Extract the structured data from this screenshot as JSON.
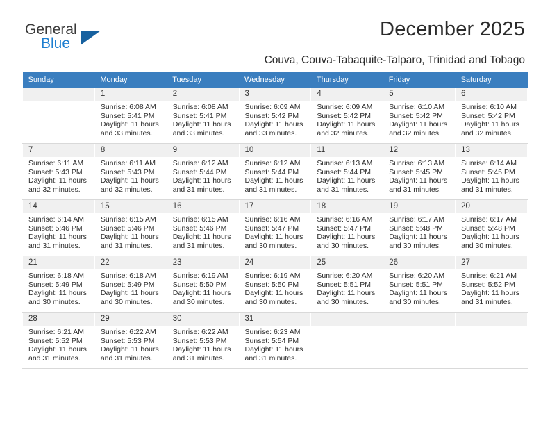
{
  "brand": {
    "name_top": "General",
    "name_bottom": "Blue",
    "triangle_icon": "triangle-icon",
    "accent_color": "#17619f",
    "blue_color": "#1f7fd0"
  },
  "header": {
    "title": "December 2025",
    "subtitle": "Couva, Couva-Tabaquite-Talparo, Trinidad and Tobago"
  },
  "calendar": {
    "header_bg": "#3a7ebf",
    "daynum_bg": "#f0f0f0",
    "weekdays": [
      "Sunday",
      "Monday",
      "Tuesday",
      "Wednesday",
      "Thursday",
      "Friday",
      "Saturday"
    ],
    "weeks": [
      [
        {
          "day": "",
          "sunrise": "",
          "sunset": "",
          "daylight": "",
          "empty": true
        },
        {
          "day": "1",
          "sunrise": "Sunrise: 6:08 AM",
          "sunset": "Sunset: 5:41 PM",
          "daylight": "Daylight: 11 hours and 33 minutes."
        },
        {
          "day": "2",
          "sunrise": "Sunrise: 6:08 AM",
          "sunset": "Sunset: 5:41 PM",
          "daylight": "Daylight: 11 hours and 33 minutes."
        },
        {
          "day": "3",
          "sunrise": "Sunrise: 6:09 AM",
          "sunset": "Sunset: 5:42 PM",
          "daylight": "Daylight: 11 hours and 33 minutes."
        },
        {
          "day": "4",
          "sunrise": "Sunrise: 6:09 AM",
          "sunset": "Sunset: 5:42 PM",
          "daylight": "Daylight: 11 hours and 32 minutes."
        },
        {
          "day": "5",
          "sunrise": "Sunrise: 6:10 AM",
          "sunset": "Sunset: 5:42 PM",
          "daylight": "Daylight: 11 hours and 32 minutes."
        },
        {
          "day": "6",
          "sunrise": "Sunrise: 6:10 AM",
          "sunset": "Sunset: 5:42 PM",
          "daylight": "Daylight: 11 hours and 32 minutes."
        }
      ],
      [
        {
          "day": "7",
          "sunrise": "Sunrise: 6:11 AM",
          "sunset": "Sunset: 5:43 PM",
          "daylight": "Daylight: 11 hours and 32 minutes."
        },
        {
          "day": "8",
          "sunrise": "Sunrise: 6:11 AM",
          "sunset": "Sunset: 5:43 PM",
          "daylight": "Daylight: 11 hours and 32 minutes."
        },
        {
          "day": "9",
          "sunrise": "Sunrise: 6:12 AM",
          "sunset": "Sunset: 5:44 PM",
          "daylight": "Daylight: 11 hours and 31 minutes."
        },
        {
          "day": "10",
          "sunrise": "Sunrise: 6:12 AM",
          "sunset": "Sunset: 5:44 PM",
          "daylight": "Daylight: 11 hours and 31 minutes."
        },
        {
          "day": "11",
          "sunrise": "Sunrise: 6:13 AM",
          "sunset": "Sunset: 5:44 PM",
          "daylight": "Daylight: 11 hours and 31 minutes."
        },
        {
          "day": "12",
          "sunrise": "Sunrise: 6:13 AM",
          "sunset": "Sunset: 5:45 PM",
          "daylight": "Daylight: 11 hours and 31 minutes."
        },
        {
          "day": "13",
          "sunrise": "Sunrise: 6:14 AM",
          "sunset": "Sunset: 5:45 PM",
          "daylight": "Daylight: 11 hours and 31 minutes."
        }
      ],
      [
        {
          "day": "14",
          "sunrise": "Sunrise: 6:14 AM",
          "sunset": "Sunset: 5:46 PM",
          "daylight": "Daylight: 11 hours and 31 minutes."
        },
        {
          "day": "15",
          "sunrise": "Sunrise: 6:15 AM",
          "sunset": "Sunset: 5:46 PM",
          "daylight": "Daylight: 11 hours and 31 minutes."
        },
        {
          "day": "16",
          "sunrise": "Sunrise: 6:15 AM",
          "sunset": "Sunset: 5:46 PM",
          "daylight": "Daylight: 11 hours and 31 minutes."
        },
        {
          "day": "17",
          "sunrise": "Sunrise: 6:16 AM",
          "sunset": "Sunset: 5:47 PM",
          "daylight": "Daylight: 11 hours and 30 minutes."
        },
        {
          "day": "18",
          "sunrise": "Sunrise: 6:16 AM",
          "sunset": "Sunset: 5:47 PM",
          "daylight": "Daylight: 11 hours and 30 minutes."
        },
        {
          "day": "19",
          "sunrise": "Sunrise: 6:17 AM",
          "sunset": "Sunset: 5:48 PM",
          "daylight": "Daylight: 11 hours and 30 minutes."
        },
        {
          "day": "20",
          "sunrise": "Sunrise: 6:17 AM",
          "sunset": "Sunset: 5:48 PM",
          "daylight": "Daylight: 11 hours and 30 minutes."
        }
      ],
      [
        {
          "day": "21",
          "sunrise": "Sunrise: 6:18 AM",
          "sunset": "Sunset: 5:49 PM",
          "daylight": "Daylight: 11 hours and 30 minutes."
        },
        {
          "day": "22",
          "sunrise": "Sunrise: 6:18 AM",
          "sunset": "Sunset: 5:49 PM",
          "daylight": "Daylight: 11 hours and 30 minutes."
        },
        {
          "day": "23",
          "sunrise": "Sunrise: 6:19 AM",
          "sunset": "Sunset: 5:50 PM",
          "daylight": "Daylight: 11 hours and 30 minutes."
        },
        {
          "day": "24",
          "sunrise": "Sunrise: 6:19 AM",
          "sunset": "Sunset: 5:50 PM",
          "daylight": "Daylight: 11 hours and 30 minutes."
        },
        {
          "day": "25",
          "sunrise": "Sunrise: 6:20 AM",
          "sunset": "Sunset: 5:51 PM",
          "daylight": "Daylight: 11 hours and 30 minutes."
        },
        {
          "day": "26",
          "sunrise": "Sunrise: 6:20 AM",
          "sunset": "Sunset: 5:51 PM",
          "daylight": "Daylight: 11 hours and 30 minutes."
        },
        {
          "day": "27",
          "sunrise": "Sunrise: 6:21 AM",
          "sunset": "Sunset: 5:52 PM",
          "daylight": "Daylight: 11 hours and 31 minutes."
        }
      ],
      [
        {
          "day": "28",
          "sunrise": "Sunrise: 6:21 AM",
          "sunset": "Sunset: 5:52 PM",
          "daylight": "Daylight: 11 hours and 31 minutes."
        },
        {
          "day": "29",
          "sunrise": "Sunrise: 6:22 AM",
          "sunset": "Sunset: 5:53 PM",
          "daylight": "Daylight: 11 hours and 31 minutes."
        },
        {
          "day": "30",
          "sunrise": "Sunrise: 6:22 AM",
          "sunset": "Sunset: 5:53 PM",
          "daylight": "Daylight: 11 hours and 31 minutes."
        },
        {
          "day": "31",
          "sunrise": "Sunrise: 6:23 AM",
          "sunset": "Sunset: 5:54 PM",
          "daylight": "Daylight: 11 hours and 31 minutes."
        },
        {
          "day": "",
          "sunrise": "",
          "sunset": "",
          "daylight": "",
          "empty": true
        },
        {
          "day": "",
          "sunrise": "",
          "sunset": "",
          "daylight": "",
          "empty": true
        },
        {
          "day": "",
          "sunrise": "",
          "sunset": "",
          "daylight": "",
          "empty": true
        }
      ]
    ]
  }
}
